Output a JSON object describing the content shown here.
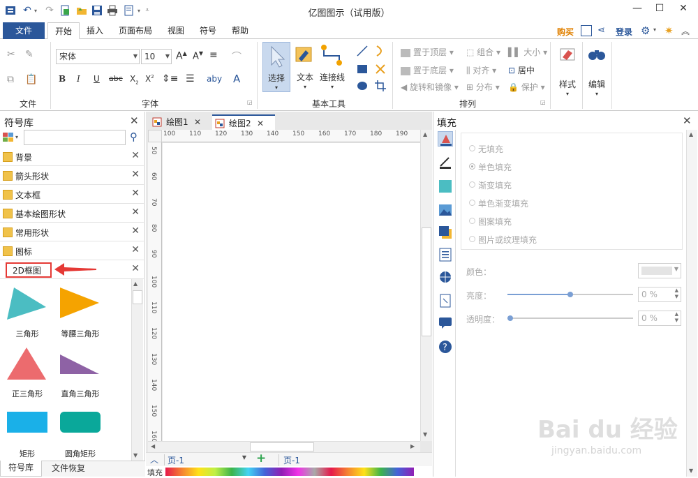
{
  "window": {
    "title": "亿图图示（试用版）"
  },
  "ribbon_tabs": [
    "文件",
    "开始",
    "插入",
    "页面布局",
    "视图",
    "符号",
    "帮助"
  ],
  "topright": {
    "buy": "购买",
    "login": "登录"
  },
  "font": {
    "family": "宋体",
    "size": "10"
  },
  "groups": {
    "file": "文件",
    "font": "字体",
    "basic_tools": "基本工具",
    "arrange": "排列"
  },
  "basic_tools": {
    "select": "选择",
    "text": "文本",
    "connector": "连接线"
  },
  "arrange": {
    "to_top": "置于顶层",
    "to_bottom": "置于底层",
    "rotate": "旋转和镜像",
    "group": "组合",
    "align": "对齐",
    "distribute": "分布",
    "size": "大小",
    "center": "居中",
    "protect": "保护"
  },
  "style_btn": "样式",
  "edit_btn": "编辑",
  "library": {
    "title": "符号库",
    "items": [
      "背景",
      "箭头形状",
      "文本框",
      "基本绘图形状",
      "常用形状",
      "图标",
      "2D框图"
    ],
    "shapes": [
      {
        "label": "三角形",
        "color": "#4bbdc2"
      },
      {
        "label": "等腰三角形",
        "color": "#f5a300"
      },
      {
        "label": "正三角形",
        "color": "#ec6b6e"
      },
      {
        "label": "直角三角形",
        "color": "#8e62a5"
      },
      {
        "label": "矩形",
        "color": "#1ab0e8"
      },
      {
        "label": "圆角矩形",
        "color": "#0aa89a"
      }
    ],
    "bottom_tabs": [
      "符号库",
      "文件恢复"
    ]
  },
  "doc_tabs": [
    "绘图1",
    "绘图2"
  ],
  "ruler_h": [
    "100",
    "110",
    "120",
    "130",
    "140",
    "150",
    "160",
    "170",
    "180",
    "190"
  ],
  "ruler_v": [
    "50",
    "60",
    "70",
    "80",
    "90",
    "100",
    "110",
    "120",
    "130",
    "140",
    "150",
    "160"
  ],
  "page_bar": {
    "page_select": "页-1",
    "page_tab": "页-1"
  },
  "fill_label": "填充",
  "fill_panel": {
    "title": "填充",
    "options": [
      "无填充",
      "单色填充",
      "渐变填充",
      "单色渐变填充",
      "图案填充",
      "图片或纹理填充"
    ],
    "color_label": "颜色：",
    "brightness_label": "亮度：",
    "brightness_value": "0 %",
    "transparency_label": "透明度：",
    "transparency_value": "0 %"
  },
  "watermark": {
    "brand": "Bai du 经验",
    "url": "jingyan.baidu.com"
  },
  "colors": {
    "accent": "#2b579a",
    "highlight": "#e53935"
  }
}
